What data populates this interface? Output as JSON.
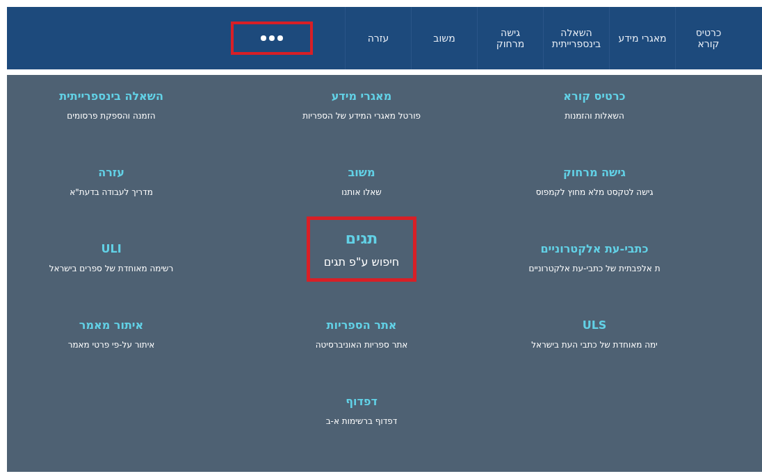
{
  "nav": {
    "items": [
      {
        "label": "כרטיס\nקורא"
      },
      {
        "label": "מאגרי מידע"
      },
      {
        "label": "השאלה\nבינספרייתית"
      },
      {
        "label": "גישה\nמרחוק"
      },
      {
        "label": "משוב"
      },
      {
        "label": "עזרה"
      }
    ],
    "more": {
      "highlighted": true
    }
  },
  "menu": {
    "columns": [
      {
        "items": [
          {
            "title": "כרטיס קורא",
            "subtitle": "השאלות והזמנות",
            "featured": false,
            "highlighted": false
          },
          {
            "title": "גישה מרחוק",
            "subtitle": "גישה לטקסט מלא מחוץ לקמפוס",
            "featured": false,
            "highlighted": false
          },
          {
            "title": "כתבי-עת אלקטרוניים",
            "subtitle": "ת אלפבתית של כתבי-עת אלקטרוניים",
            "featured": false,
            "highlighted": false
          },
          {
            "title": "ULS",
            "subtitle": "ימה מאוחדת של כתבי העת בישראל",
            "featured": false,
            "highlighted": false
          }
        ]
      },
      {
        "items": [
          {
            "title": "מאגרי מידע",
            "subtitle": "פורטל מאגרי המידע של הספריות",
            "featured": false,
            "highlighted": false
          },
          {
            "title": "משוב",
            "subtitle": "שאלו אותנו",
            "featured": false,
            "highlighted": false
          },
          {
            "title": "תגים",
            "subtitle": "חיפוש ע\"פ תגים",
            "featured": true,
            "highlighted": true
          },
          {
            "title": "אתר הספריות",
            "subtitle": "אתר ספריות האוניברסיטה",
            "featured": false,
            "highlighted": false
          },
          {
            "title": "דפדוף",
            "subtitle": "דפדוף ברשימות א-ב",
            "featured": false,
            "highlighted": false
          }
        ]
      },
      {
        "items": [
          {
            "title": "השאלה בינספרייתית",
            "subtitle": "הזמנה והספקת פרסומים",
            "featured": false,
            "highlighted": false
          },
          {
            "title": "עזרה",
            "subtitle": "מדריך לעבודה בדעת\"א",
            "featured": false,
            "highlighted": false
          },
          {
            "title": "ULI",
            "subtitle": "רשימה מאוחדת של ספרים בישראל",
            "featured": false,
            "highlighted": false
          },
          {
            "title": "איתור מאמר",
            "subtitle": "איתור על-פי פרטי מאמר",
            "featured": false,
            "highlighted": false
          }
        ]
      }
    ]
  }
}
